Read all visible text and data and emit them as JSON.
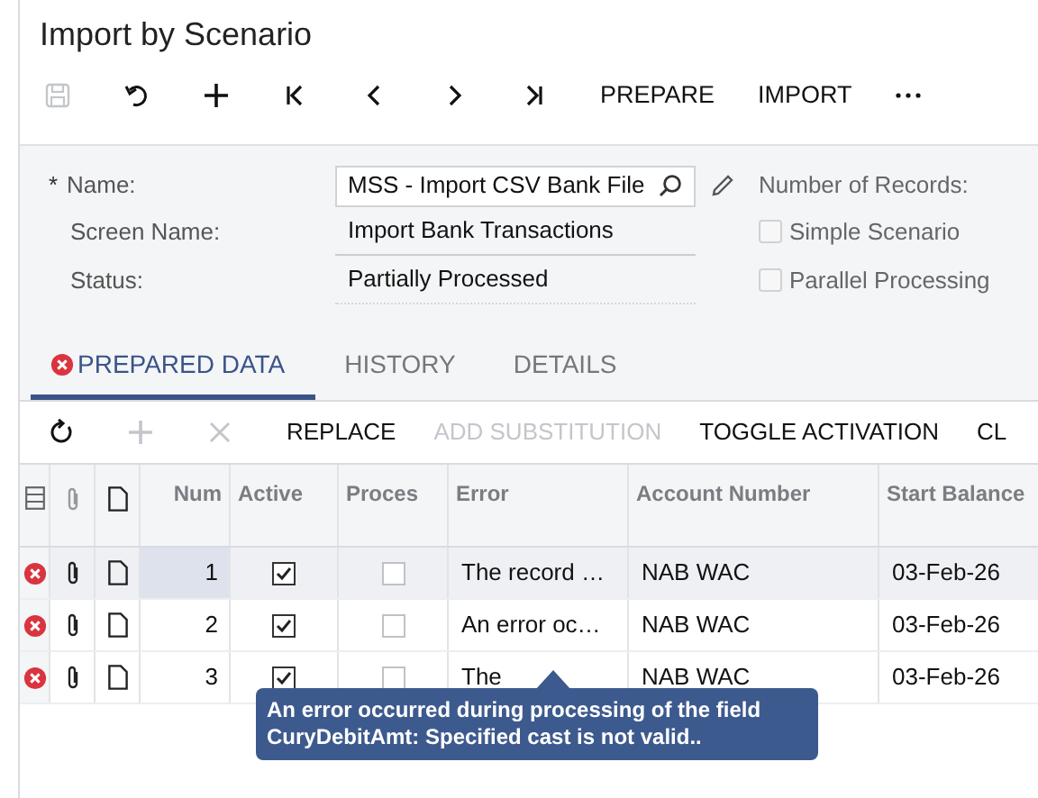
{
  "window": {
    "title": "Import by Scenario"
  },
  "toolbar": [
    {
      "kind": "save",
      "disabled": true
    },
    {
      "kind": "undo",
      "disabled": false
    },
    {
      "kind": "add",
      "disabled": false
    },
    {
      "kind": "first",
      "disabled": false
    },
    {
      "kind": "prev",
      "disabled": false
    },
    {
      "kind": "next",
      "disabled": false
    },
    {
      "kind": "last",
      "disabled": false
    },
    {
      "kind": "text",
      "label": "PREPARE",
      "disabled": false
    },
    {
      "kind": "text",
      "label": "IMPORT",
      "disabled": false
    },
    {
      "kind": "more",
      "disabled": false
    }
  ],
  "form": {
    "name": {
      "label": "Name:",
      "required_mark": "*",
      "value": "MSS - Import CSV Bank File"
    },
    "screen_name": {
      "label": "Screen Name:",
      "value": "Import Bank Transactions"
    },
    "status": {
      "label": "Status:",
      "value": "Partially Processed"
    },
    "number_of_records": {
      "label": "Number of Records:"
    },
    "checkboxes": [
      {
        "label": "Simple Scenario",
        "checked": false
      },
      {
        "label": "Parallel Processing",
        "checked": false
      }
    ]
  },
  "tabs": [
    {
      "label": "PREPARED DATA",
      "selected": true,
      "has_error": true
    },
    {
      "label": "HISTORY",
      "selected": false,
      "has_error": false
    },
    {
      "label": "DETAILS",
      "selected": false,
      "has_error": false
    }
  ],
  "grid_toolbar": [
    {
      "kind": "refresh",
      "disabled": false
    },
    {
      "kind": "add",
      "disabled": true
    },
    {
      "kind": "delete",
      "disabled": true
    },
    {
      "kind": "text",
      "label": "REPLACE",
      "disabled": false
    },
    {
      "kind": "text",
      "label": "ADD SUBSTITUTION",
      "disabled": true
    },
    {
      "kind": "text",
      "label": "TOGGLE ACTIVATION",
      "disabled": false
    },
    {
      "kind": "text",
      "label": "CL",
      "disabled": false
    }
  ],
  "table": {
    "columns": [
      "Num",
      "Active",
      "Proces",
      "Error",
      "Account Number",
      "Start Balance"
    ],
    "rows": [
      {
        "has_error": true,
        "selected": true,
        "num": "1",
        "active": true,
        "processed": false,
        "error": "The record …",
        "account": "NAB WAC",
        "start_balance_date": "03-Feb-26"
      },
      {
        "has_error": true,
        "selected": false,
        "num": "2",
        "active": true,
        "processed": false,
        "error": "An error oc…",
        "account": "NAB WAC",
        "start_balance_date": "03-Feb-26"
      },
      {
        "has_error": true,
        "selected": false,
        "num": "3",
        "active": true,
        "processed": false,
        "error": "The",
        "account": "NAB WAC",
        "start_balance_date": "03-Feb-26"
      }
    ]
  },
  "tooltip": {
    "text": "An error occurred during processing of the field CuryDebitAmt: Specified cast is not valid.."
  }
}
